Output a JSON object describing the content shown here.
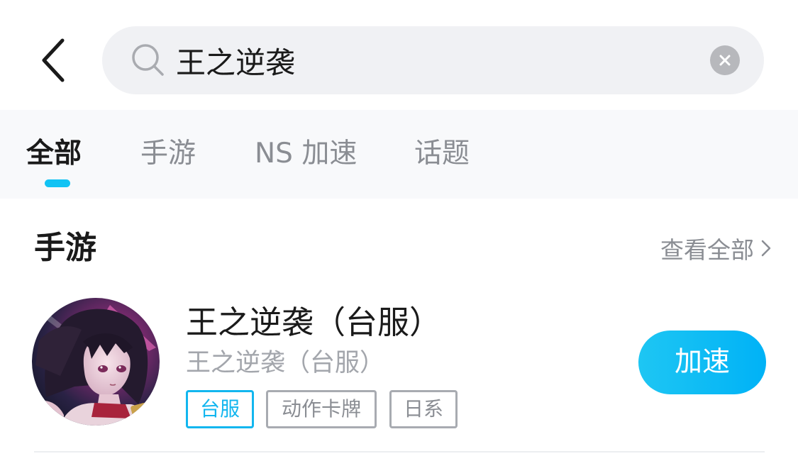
{
  "search": {
    "value": "王之逆袭",
    "back_icon": "chevron-left-icon",
    "search_icon": "search-icon",
    "clear_icon": "close-circle-icon"
  },
  "tabs": [
    {
      "label": "全部",
      "active": true
    },
    {
      "label": "手游",
      "active": false
    },
    {
      "label": "NS 加速",
      "active": false
    },
    {
      "label": "话题",
      "active": false
    }
  ],
  "section": {
    "title": "手游",
    "view_all": "查看全部",
    "view_all_icon": "chevron-right-icon"
  },
  "game": {
    "name": "王之逆袭（台服）",
    "subname": "王之逆袭（台服）",
    "tags": [
      "台服",
      "动作卡牌",
      "日系"
    ],
    "action_label": "加速",
    "avatar": "anime-character-avatar"
  },
  "colors": {
    "accent": "#12c3f4",
    "button_start": "#1ec6f3",
    "button_end": "#00b2f6",
    "secondary_text": "#8a8d93",
    "search_bg": "#f0f1f4"
  }
}
